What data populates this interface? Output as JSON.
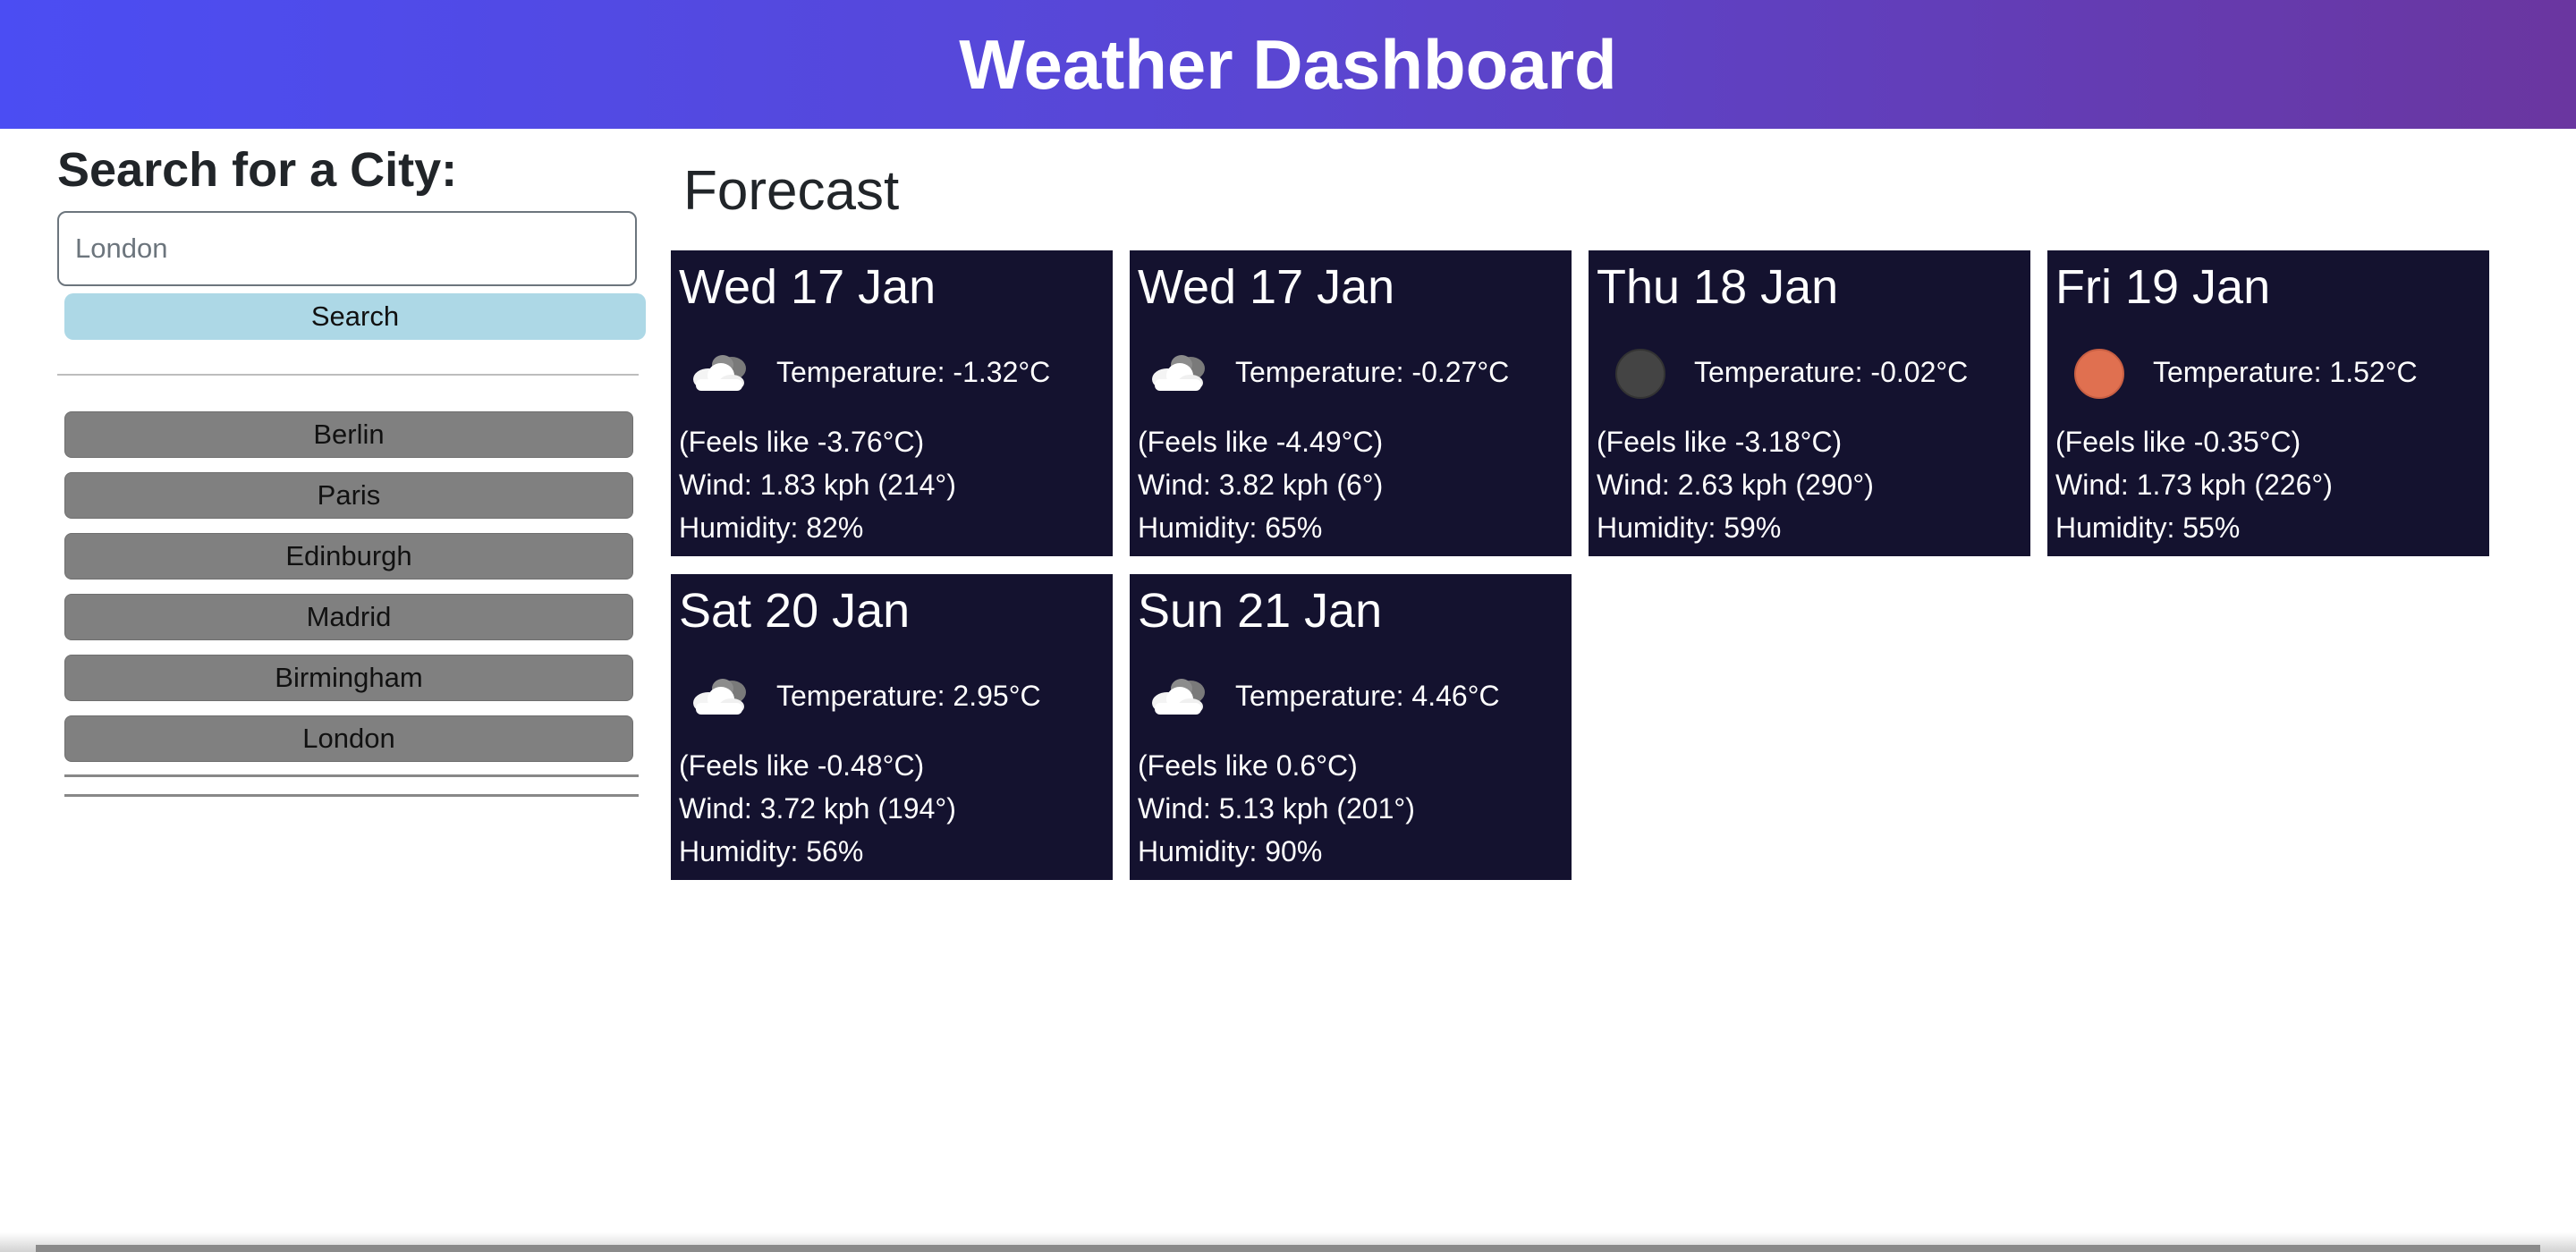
{
  "header": {
    "title": "Weather Dashboard"
  },
  "sidebar": {
    "heading": "Search for a City:",
    "search_placeholder": "London",
    "search_button_label": "Search",
    "history": [
      "Berlin",
      "Paris",
      "Edinburgh",
      "Madrid",
      "Birmingham",
      "London"
    ]
  },
  "forecast": {
    "title": "Forecast",
    "cards": [
      {
        "date": "Wed 17 Jan",
        "icon": "cloud-icon",
        "temperature": "Temperature: -1.32°C",
        "feels": "(Feels like -3.76°C)",
        "wind": "Wind: 1.83 kph (214°)",
        "humidity": "Humidity: 82%"
      },
      {
        "date": "Wed 17 Jan",
        "icon": "cloud-icon",
        "temperature": "Temperature: -0.27°C",
        "feels": "(Feels like -4.49°C)",
        "wind": "Wind: 3.82 kph (6°)",
        "humidity": "Humidity: 65%"
      },
      {
        "date": "Thu 18 Jan",
        "icon": "dark-circle-icon",
        "temperature": "Temperature: -0.02°C",
        "feels": "(Feels like -3.18°C)",
        "wind": "Wind: 2.63 kph (290°)",
        "humidity": "Humidity: 59%"
      },
      {
        "date": "Fri 19 Jan",
        "icon": "orange-circle-icon",
        "temperature": "Temperature: 1.52°C",
        "feels": "(Feels like -0.35°C)",
        "wind": "Wind: 1.73 kph (226°)",
        "humidity": "Humidity: 55%"
      },
      {
        "date": "Sat 20 Jan",
        "icon": "cloud-icon",
        "temperature": "Temperature: 2.95°C",
        "feels": "(Feels like -0.48°C)",
        "wind": "Wind: 3.72 kph (194°)",
        "humidity": "Humidity: 56%"
      },
      {
        "date": "Sun 21 Jan",
        "icon": "cloud-icon",
        "temperature": "Temperature: 4.46°C",
        "feels": "(Feels like 0.6°C)",
        "wind": "Wind: 5.13 kph (201°)",
        "humidity": "Humidity: 90%"
      }
    ]
  },
  "colors": {
    "header_start": "#4b4df3",
    "header_end": "#6a36a0",
    "card_bg": "#14122f",
    "search_button": "#add8e6",
    "history_button": "#808080",
    "dark_circle": "#444444",
    "orange_circle": "#e07050"
  }
}
